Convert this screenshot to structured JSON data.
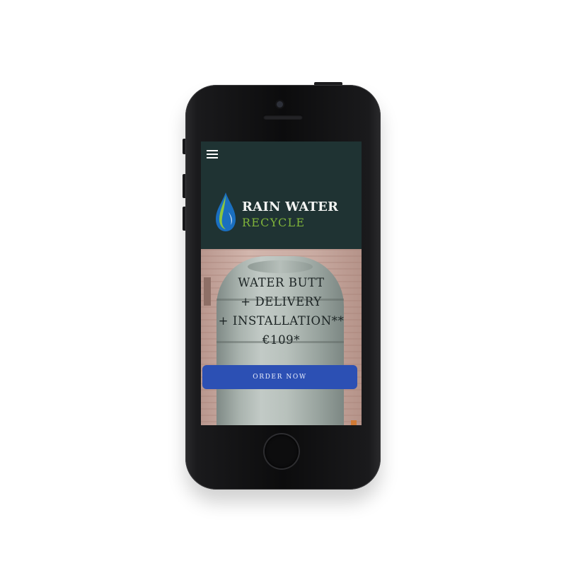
{
  "site": {
    "logo": {
      "line1": "RAIN WATER",
      "line2": "RECYCLE"
    },
    "menu_icon": "hamburger-menu-icon"
  },
  "hero": {
    "lines": [
      "WATER BUTT",
      "+ DELIVERY",
      "+ INSTALLATION**",
      "€109*"
    ],
    "cta_label": "ORDER NOW"
  },
  "colors": {
    "header_bg": "#1f3333",
    "logo_green": "#7fb33a",
    "drop_blue": "#1a6fc0",
    "cta_blue": "#2c50b4"
  }
}
